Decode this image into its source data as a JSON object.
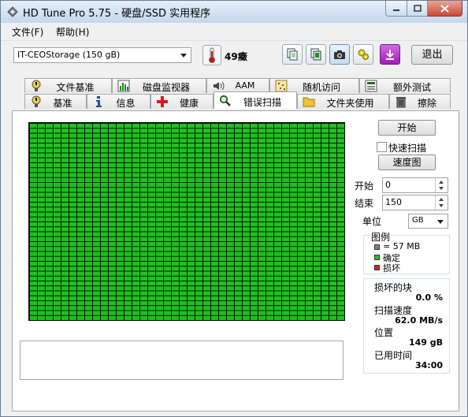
{
  "window": {
    "title": "HD Tune Pro 5.75 - 硬盘/SSD 实用程序",
    "controls": [
      "minimize",
      "maximize",
      "close"
    ]
  },
  "menu": [
    {
      "label": "文件(F)"
    },
    {
      "label": "帮助(H)"
    }
  ],
  "toolbar": {
    "drive": "IT-CEOStorage (150 gB)",
    "temperature": "49癥",
    "exit_label": "退出",
    "buttons": [
      "copy-text-icon",
      "copy-screen-icon",
      "camera-icon",
      "settings-icon",
      "save-icon"
    ]
  },
  "tabs": {
    "row1": [
      {
        "label": "文件基准",
        "icon": "file-benchmark-icon"
      },
      {
        "label": "磁盘监视器",
        "icon": "disk-monitor-icon"
      },
      {
        "label": "AAM",
        "icon": "speaker-icon"
      },
      {
        "label": "随机访问",
        "icon": "random-access-icon"
      },
      {
        "label": "额外测试",
        "icon": "extra-tests-icon"
      }
    ],
    "row2": [
      {
        "label": "基准",
        "icon": "benchmark-icon"
      },
      {
        "label": "信息",
        "icon": "info-icon"
      },
      {
        "label": "健康",
        "icon": "health-icon"
      },
      {
        "label": "错误扫描",
        "icon": "magnifier-icon",
        "active": true
      },
      {
        "label": "文件夹使用",
        "icon": "folder-icon"
      },
      {
        "label": "擦除",
        "icon": "erase-icon"
      }
    ]
  },
  "scan": {
    "start_button": "开始",
    "quick_scan_label": "快速扫描",
    "quick_scan_checked": false,
    "speed_map_button": "速度图",
    "start_label": "开始",
    "start_value": "0",
    "end_label": "结束",
    "end_value": "150",
    "unit_label": "单位",
    "unit_value": "GB",
    "grid": {
      "columns": 40,
      "rows": 40,
      "ok_fraction": 1.0
    }
  },
  "legend": {
    "title": "图例",
    "items": [
      {
        "label": "= 57 MB",
        "color": "#808080"
      },
      {
        "label": "确定",
        "color": "#20c020"
      },
      {
        "label": "损坏",
        "color": "#e02020"
      }
    ]
  },
  "stats": {
    "damaged_label": "损坏的块",
    "damaged_value": "0.0 %",
    "speed_label": "扫描速度",
    "speed_value": "62.0 MB/s",
    "position_label": "位置",
    "position_value": "149 gB",
    "elapsed_label": "已用时间",
    "elapsed_value": "34:00"
  },
  "log_text": ""
}
